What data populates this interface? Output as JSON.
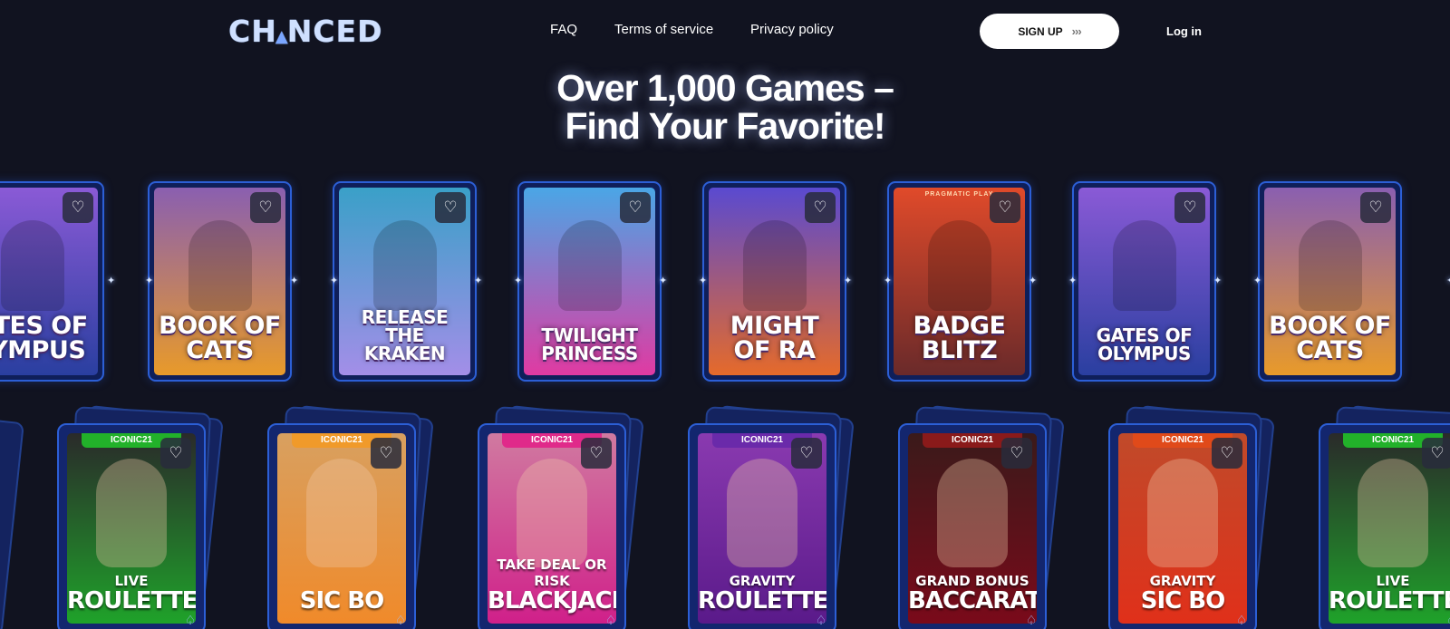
{
  "header": {
    "logo_text_a": "CH",
    "logo_text_b": "NCED",
    "nav": [
      "FAQ",
      "Terms of service",
      "Privacy policy"
    ],
    "signup_label": "SIGN UP",
    "signup_chevrons": "›››",
    "login_label": "Log in"
  },
  "hero": {
    "line1": "Over 1,000 Games –",
    "line2": "Find Your Favorite!"
  },
  "slots": [
    {
      "title": "GATES OF OLYMPUS",
      "title_shown": "ATES OF LYMPUS",
      "bg": [
        "#8a5ad6",
        "#2a3fa0"
      ]
    },
    {
      "title": "BOOK OF CATS",
      "title_shown": "BOOK OF CATS",
      "bg": [
        "#8a5fb0",
        "#e89a2a"
      ]
    },
    {
      "title": "RELEASE THE KRAKEN",
      "title_shown": "RELEASE THE KRAKEN",
      "bg": [
        "#3aa0c8",
        "#a38ee8"
      ]
    },
    {
      "title": "TWILIGHT PRINCESS",
      "title_shown": "TWILIGHT PRINCESS",
      "bg": [
        "#4aa6e6",
        "#e03aa2"
      ]
    },
    {
      "title": "MIGHT OF RA",
      "title_shown": "MIGHT OF RA",
      "bg": [
        "#5a4ad0",
        "#e56a2a"
      ]
    },
    {
      "title": "BADGE BLITZ",
      "title_shown": "BADGE BLITZ",
      "bg": [
        "#e04a2a",
        "#6a2a2a"
      ],
      "provider": "PRAGMATIC PLAY"
    },
    {
      "title": "GATES OF OLYMPUS",
      "title_shown": "GATES OF OLYMPUS",
      "bg": [
        "#8a5ad6",
        "#2a3fa0"
      ]
    },
    {
      "title": "BOOK OF CATS",
      "title_shown": "BOOK OF CATS",
      "bg": [
        "#8a5fb0",
        "#e89a2a"
      ]
    }
  ],
  "live_games": [
    {
      "tag": "ICONIC21",
      "tag_color": "#22b12a",
      "line1": "LIVE",
      "line2": "ROULETTE",
      "bg": [
        "#2a2a2a",
        "#1fa22a"
      ]
    },
    {
      "tag": "ICONIC21",
      "tag_color": "#f09a2a",
      "line1": "",
      "line2": "SIC BO",
      "bg": [
        "#d8a060",
        "#f08a2a"
      ]
    },
    {
      "tag": "ICONIC21",
      "tag_color": "#e02a8a",
      "line1": "TAKE DEAL OR RISK",
      "line2": "BLACKJACK",
      "bg": [
        "#d07aa0",
        "#d0208a"
      ]
    },
    {
      "tag": "ICONIC21",
      "tag_color": "#6a2aaa",
      "line1": "GRAVITY",
      "line2": "ROULETTE",
      "bg": [
        "#8a3ab0",
        "#5a1a8a"
      ]
    },
    {
      "tag": "ICONIC21",
      "tag_color": "#8a1a1a",
      "line1": "GRAND BONUS",
      "line2": "BACCARAT",
      "bg": [
        "#3a1a1a",
        "#7a0a1a"
      ]
    },
    {
      "tag": "ICONIC21",
      "tag_color": "#e04a1a",
      "line1": "GRAVITY",
      "line2": "SIC BO",
      "bg": [
        "#c04a2a",
        "#e0301a"
      ]
    },
    {
      "tag": "ICONIC21",
      "tag_color": "#22b12a",
      "line1": "LIVE",
      "line2": "ROULETTE",
      "bg": [
        "#2a2a2a",
        "#1fa22a"
      ]
    }
  ],
  "icons": {
    "heart": "heart-icon",
    "spade": "spade-icon",
    "sparkle": "sparkle-icon"
  }
}
